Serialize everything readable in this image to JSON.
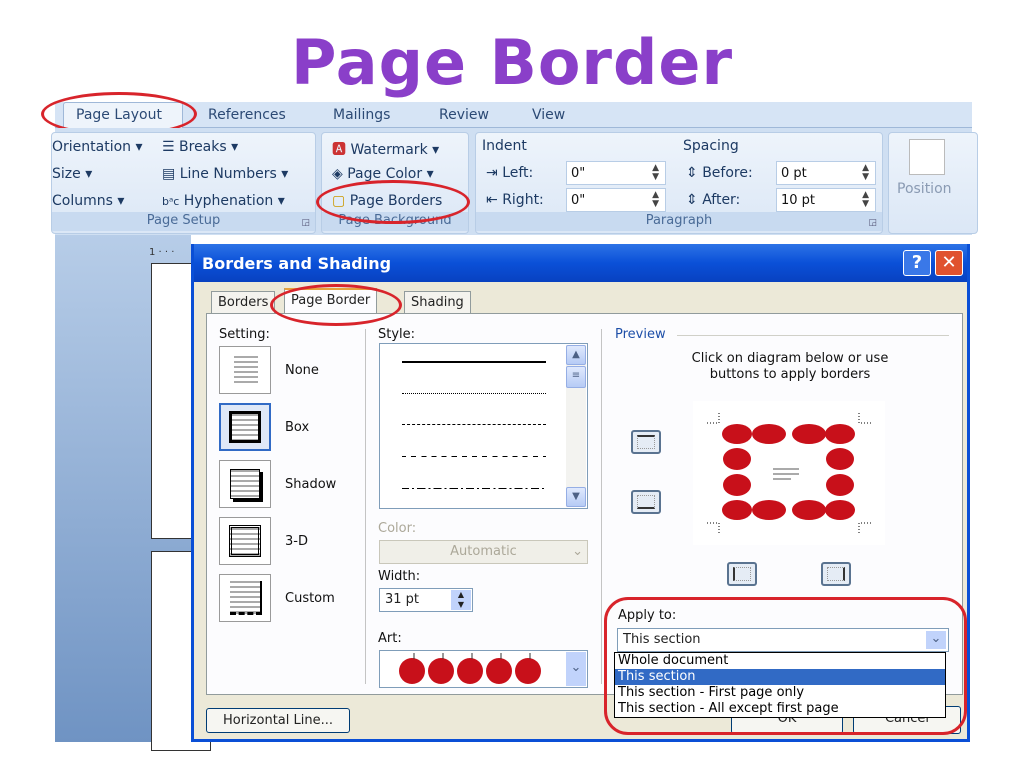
{
  "slide_title": "Page Border",
  "ribbon": {
    "tabs": [
      "Page Layout",
      "References",
      "Mailings",
      "Review",
      "View"
    ],
    "active_tab": "Page Layout",
    "page_setup": {
      "items": [
        "Orientation",
        "Size",
        "Columns",
        "Breaks",
        "Line Numbers",
        "Hyphenation"
      ],
      "label": "Page Setup"
    },
    "page_background": {
      "items": [
        "Watermark",
        "Page Color",
        "Page Borders"
      ],
      "label": "Page Background"
    },
    "paragraph": {
      "indent_label": "Indent",
      "left_label": "Left:",
      "left_value": "0\"",
      "right_label": "Right:",
      "right_value": "0\"",
      "spacing_label": "Spacing",
      "before_label": "Before:",
      "before_value": "0 pt",
      "after_label": "After:",
      "after_value": "10 pt",
      "label": "Paragraph"
    },
    "arrange": {
      "position_label": "Position"
    }
  },
  "ruler": "1 · · ·",
  "dialog": {
    "title": "Borders and Shading",
    "help": "?",
    "close": "✕",
    "tabs": [
      "Borders",
      "Page Border",
      "Shading"
    ],
    "active_tab": "Page Border",
    "setting_label": "Setting:",
    "settings": [
      "None",
      "Box",
      "Shadow",
      "3-D",
      "Custom"
    ],
    "selected_setting": "Box",
    "style_label": "Style:",
    "color_label": "Color:",
    "color_value": "Automatic",
    "width_label": "Width:",
    "width_value": "31 pt",
    "art_label": "Art:",
    "preview_label": "Preview",
    "preview_hint_1": "Click on diagram below or use",
    "preview_hint_2": "buttons to apply borders",
    "apply_label": "Apply to:",
    "apply_value": "This section",
    "apply_options": [
      "Whole document",
      "This section",
      "This section - First page only",
      "This section - All except first page"
    ],
    "horizontal_line": "Horizontal Line...",
    "ok": "OK",
    "cancel": "Cancel"
  },
  "colors": {
    "title": "#8a3fc9",
    "highlight": "#d8242b",
    "titlebar": "#0a50d8",
    "art": "#c8101a"
  }
}
